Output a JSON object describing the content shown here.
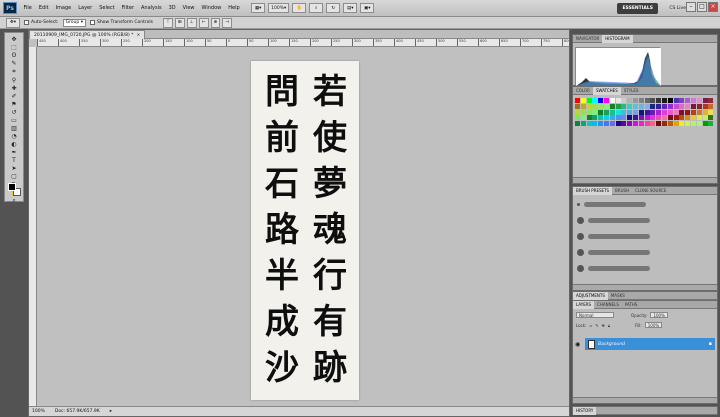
{
  "app": {
    "logo": "Ps",
    "menu": [
      "File",
      "Edit",
      "Image",
      "Layer",
      "Select",
      "Filter",
      "Analysis",
      "3D",
      "View",
      "Window",
      "Help"
    ],
    "zoom_menu": "100%",
    "workspace": "ESSENTIALS",
    "cs_live": "CS Live",
    "win_min": "–",
    "win_max": "□",
    "win_close": "×"
  },
  "options": {
    "auto_select_label": "Auto-Select:",
    "auto_select_value": "Group",
    "transform_label": "Show Transform Controls"
  },
  "document": {
    "tab_title": "20110909_IMG_0720.JPG @ 100% (RGB/8) *",
    "ruler_ticks": [
      "450",
      "400",
      "350",
      "300",
      "250",
      "200",
      "150",
      "100",
      "50",
      "0",
      "50",
      "100",
      "150",
      "200",
      "250",
      "300",
      "350",
      "400",
      "450",
      "500",
      "550",
      "600",
      "650",
      "700",
      "750",
      "800"
    ],
    "zoom": "100%",
    "doc_size": "Doc: 657.9K/657.9K",
    "columns": [
      [
        "問",
        "前",
        "石",
        "路",
        "半",
        "成",
        "沙"
      ],
      [
        "若",
        "使",
        "夢",
        "魂",
        "行",
        "有",
        "跡"
      ]
    ]
  },
  "panels": {
    "top_tabs": [
      "NAVIGATOR",
      "HISTOGRAM"
    ],
    "color_tabs": [
      "COLOR",
      "SWATCHES",
      "STYLES"
    ],
    "brush_tabs": [
      "BRUSH PRESETS",
      "BRUSH",
      "CLONE SOURCE"
    ],
    "adjust_tabs": [
      "ADJUSTMENTS",
      "MASKS"
    ],
    "layers_tabs": [
      "LAYERS",
      "CHANNELS",
      "PATHS"
    ],
    "blend_mode": "Normal",
    "opacity_label": "Opacity:",
    "opacity_value": "100%",
    "lock_label": "Lock:",
    "fill_label": "Fill:",
    "fill_value": "100%",
    "layer_name": "Background",
    "history_tab": "HISTORY"
  }
}
